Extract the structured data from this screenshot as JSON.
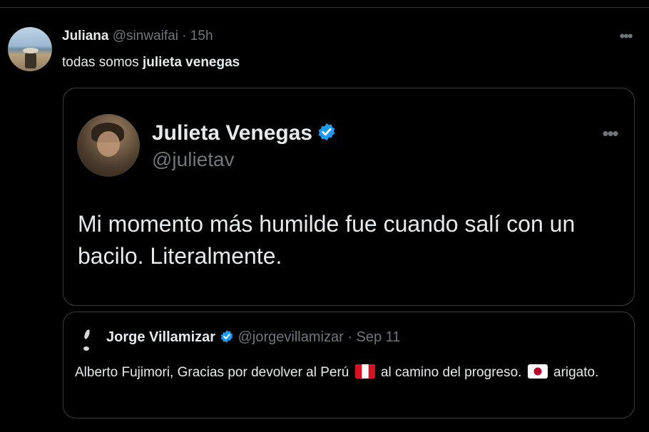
{
  "tweet": {
    "author_name": "Juliana",
    "author_handle": "@sinwaifai",
    "time": "· 15h",
    "more_icon": "more-horizontal-icon",
    "text_plain": "todas somos ",
    "text_bold": "julieta venegas"
  },
  "quoted": {
    "author_name": "Julieta Venegas",
    "author_handle": "@julietav",
    "verified_icon": "verified-badge-icon",
    "more_icon": "more-horizontal-icon",
    "text": "Mi momento más humilde fue cuando salí con un bacilo. Literalmente."
  },
  "nested_quote": {
    "author_name": "Jorge Villamizar",
    "author_handle": "@jorgevillamizar",
    "date": "· Sep 11",
    "verified_icon": "verified-badge-icon",
    "text_part1": "Alberto Fujimori, Gracias por devolver al Perú",
    "flag1_icon": "peru-flag-icon",
    "text_part2": "al camino del progreso.",
    "flag2_icon": "japan-flag-icon",
    "text_part3": "arigato."
  },
  "colors": {
    "background": "#000000",
    "text": "#e7e9ea",
    "secondary": "#71767b",
    "verified": "#1d9bf0",
    "border": "#3a3d40"
  }
}
